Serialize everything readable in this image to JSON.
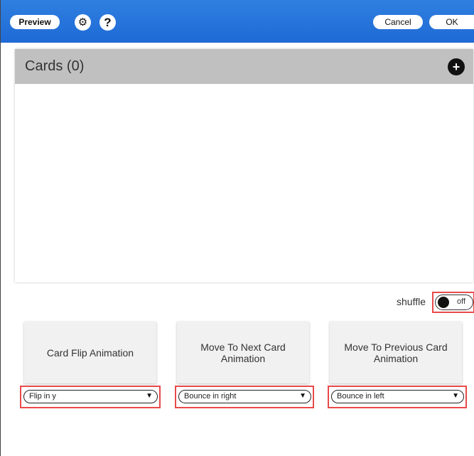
{
  "toolbar": {
    "preview_label": "Preview",
    "gear_icon": "gear-icon",
    "help_label": "?",
    "cancel_label": "Cancel",
    "ok_label": "OK"
  },
  "cards": {
    "title": "Cards (0)",
    "add_label": "+"
  },
  "shuffle": {
    "label": "shuffle",
    "state": "off"
  },
  "animations": [
    {
      "title": "Card Flip Animation",
      "selected": "Flip in y"
    },
    {
      "title": "Move To Next Card Animation",
      "selected": "Bounce in right"
    },
    {
      "title": "Move To Previous Card Animation",
      "selected": "Bounce in left"
    }
  ],
  "colors": {
    "header": "#1f6ad6",
    "highlight": "#e84a4a",
    "cards_header": "#c0c0c0"
  }
}
